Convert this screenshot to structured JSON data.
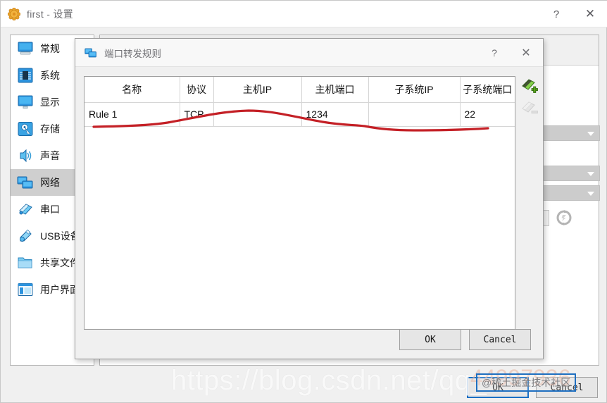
{
  "main_window": {
    "title": "first - 设置",
    "app_icon": "virtualbox-settings-icon",
    "help_label": "?",
    "close_label": "✕",
    "sidebar": {
      "items": [
        {
          "label": "常规",
          "icon": "monitor-general-icon",
          "selected": false
        },
        {
          "label": "系统",
          "icon": "chip-system-icon",
          "selected": false
        },
        {
          "label": "显示",
          "icon": "monitor-display-icon",
          "selected": false
        },
        {
          "label": "存储",
          "icon": "harddisk-storage-icon",
          "selected": false
        },
        {
          "label": "声音",
          "icon": "speaker-audio-icon",
          "selected": false
        },
        {
          "label": "网络",
          "icon": "network-icon",
          "selected": true
        },
        {
          "label": "串口",
          "icon": "serial-port-icon",
          "selected": false
        },
        {
          "label": "USB设备",
          "icon": "usb-icon",
          "selected": false
        },
        {
          "label": "共享文件夹",
          "icon": "folder-shared-icon",
          "selected": false
        },
        {
          "label": "用户界面",
          "icon": "user-interface-icon",
          "selected": false
        }
      ]
    },
    "buttons": {
      "ok_label": "OK",
      "cancel_label": "Cancel"
    }
  },
  "dialog": {
    "title": "端口转发规则",
    "icon": "network-dialog-icon",
    "help_label": "?",
    "close_label": "✕",
    "table": {
      "columns": [
        "名称",
        "协议",
        "主机IP",
        "主机端口",
        "子系统IP",
        "子系统端口"
      ],
      "rows": [
        {
          "cells": [
            "Rule 1",
            "TCP",
            "",
            "1234",
            "",
            "22"
          ]
        }
      ]
    },
    "tools": [
      {
        "name": "add-rule-icon",
        "title": "添加规则",
        "enabled": true
      },
      {
        "name": "remove-rule-icon",
        "title": "删除规则",
        "enabled": false
      }
    ],
    "buttons": {
      "ok_label": "OK",
      "cancel_label": "Cancel"
    }
  },
  "annotation": {
    "type": "hand-drawn-red-underline",
    "color": "#c42026"
  },
  "watermark": {
    "url_text": "https://blog.csdn.net/qq_",
    "number_text": "44997936",
    "badge_text": "@稀土掘金技术社区"
  },
  "colors": {
    "accent_blue": "#1f6fc0",
    "annotation_red": "#c42026",
    "selection_grey": "#cfcfcf",
    "window_grey": "#f0f0f0"
  }
}
